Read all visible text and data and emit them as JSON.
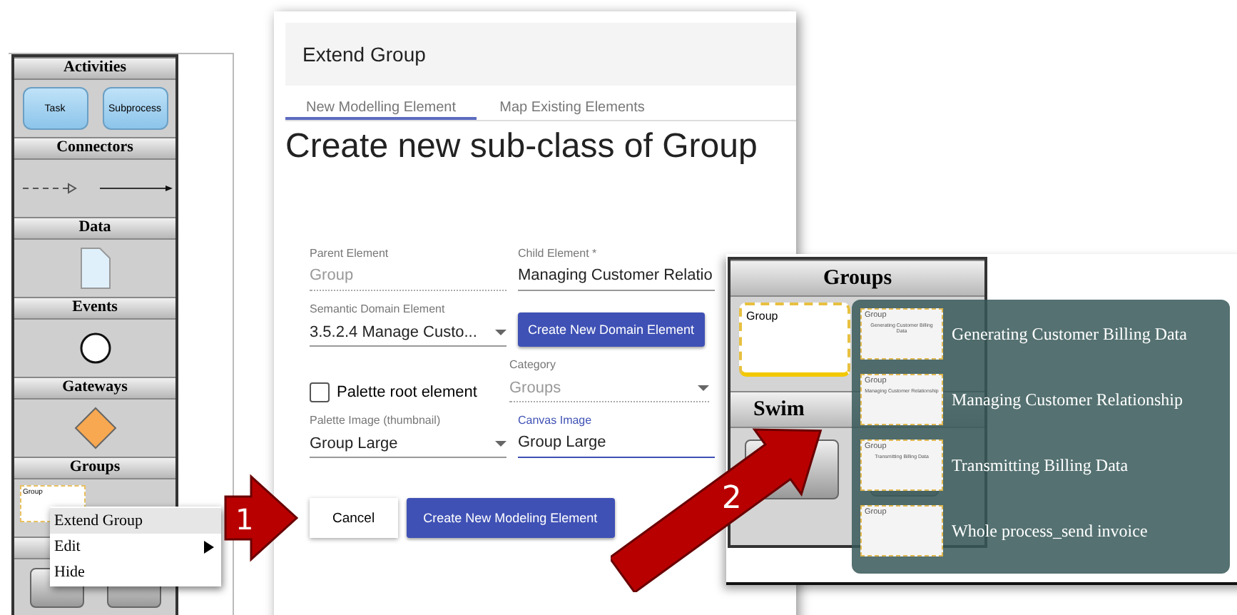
{
  "palette": {
    "sections": [
      {
        "title": "Activities",
        "kind": "activities",
        "items": [
          "Task",
          "Subprocess"
        ]
      },
      {
        "title": "Connectors",
        "kind": "connectors"
      },
      {
        "title": "Data",
        "kind": "data"
      },
      {
        "title": "Events",
        "kind": "events"
      },
      {
        "title": "Gateways",
        "kind": "gateways"
      },
      {
        "title": "Groups",
        "kind": "groups",
        "items": [
          "Group"
        ]
      }
    ]
  },
  "context_menu": {
    "items": [
      {
        "label": "Extend Group",
        "selected": true,
        "submenu": false
      },
      {
        "label": "Edit",
        "selected": false,
        "submenu": true
      },
      {
        "label": "Hide",
        "selected": false,
        "submenu": false
      }
    ]
  },
  "dialog": {
    "title": "Extend Group",
    "tabs": [
      {
        "label": "New Modelling Element",
        "selected": true
      },
      {
        "label": "Map Existing Elements",
        "selected": false
      }
    ],
    "heading": "Create new sub-class of Group",
    "parent_element": {
      "label": "Parent Element",
      "value": "Group",
      "disabled": true
    },
    "child_element": {
      "label": "Child Element *",
      "value": "Managing Customer Relatio",
      "disabled": false
    },
    "semantic_domain_element": {
      "label": "Semantic Domain Element",
      "value": "3.5.2.4 Manage Custo..."
    },
    "create_domain_button": "Create New Domain Element",
    "palette_root": {
      "label": "Palette root element",
      "checked": false
    },
    "category": {
      "label": "Category",
      "value": "Groups",
      "disabled": true
    },
    "palette_image": {
      "label": "Palette Image (thumbnail)",
      "value": "Group Large"
    },
    "canvas_image": {
      "label": "Canvas Image",
      "value": "Group Large",
      "focused": true
    },
    "buttons": [
      "Cancel",
      "Create New Modeling Element"
    ]
  },
  "callouts": [
    "1",
    "2"
  ],
  "groups_panel": {
    "title": "Groups",
    "group_label": "Group",
    "swimlanes_title": "Swim",
    "extensions": [
      {
        "thumb_label": "Group",
        "thumb_caption": "Generating Customer Billing Data",
        "label": "Generating Customer Billing Data"
      },
      {
        "thumb_label": "Group",
        "thumb_caption": "Managing Customer Relationship",
        "label": "Managing Customer Relationship"
      },
      {
        "thumb_label": "Group",
        "thumb_caption": "Transmitting Billing Data",
        "label": "Transmitting Billing Data"
      },
      {
        "thumb_label": "Group",
        "label": "Whole process_send invoice"
      }
    ]
  }
}
